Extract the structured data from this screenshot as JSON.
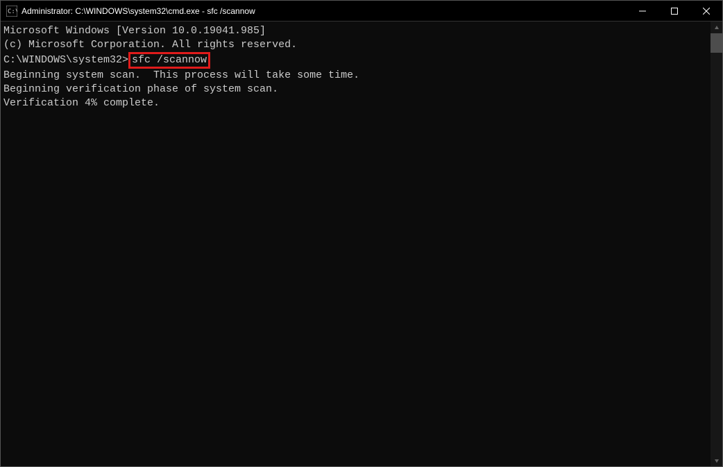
{
  "titlebar": {
    "title": "Administrator: C:\\WINDOWS\\system32\\cmd.exe - sfc  /scannow"
  },
  "terminal": {
    "line1": "Microsoft Windows [Version 10.0.19041.985]",
    "line2": "(c) Microsoft Corporation. All rights reserved.",
    "blank1": "",
    "prompt_path": "C:\\WINDOWS\\system32>",
    "command": "sfc /scannow",
    "blank2": "",
    "scan_msg": "Beginning system scan.  This process will take some time.",
    "blank3": "",
    "verify_msg": "Beginning verification phase of system scan.",
    "progress_msg": "Verification 4% complete."
  }
}
